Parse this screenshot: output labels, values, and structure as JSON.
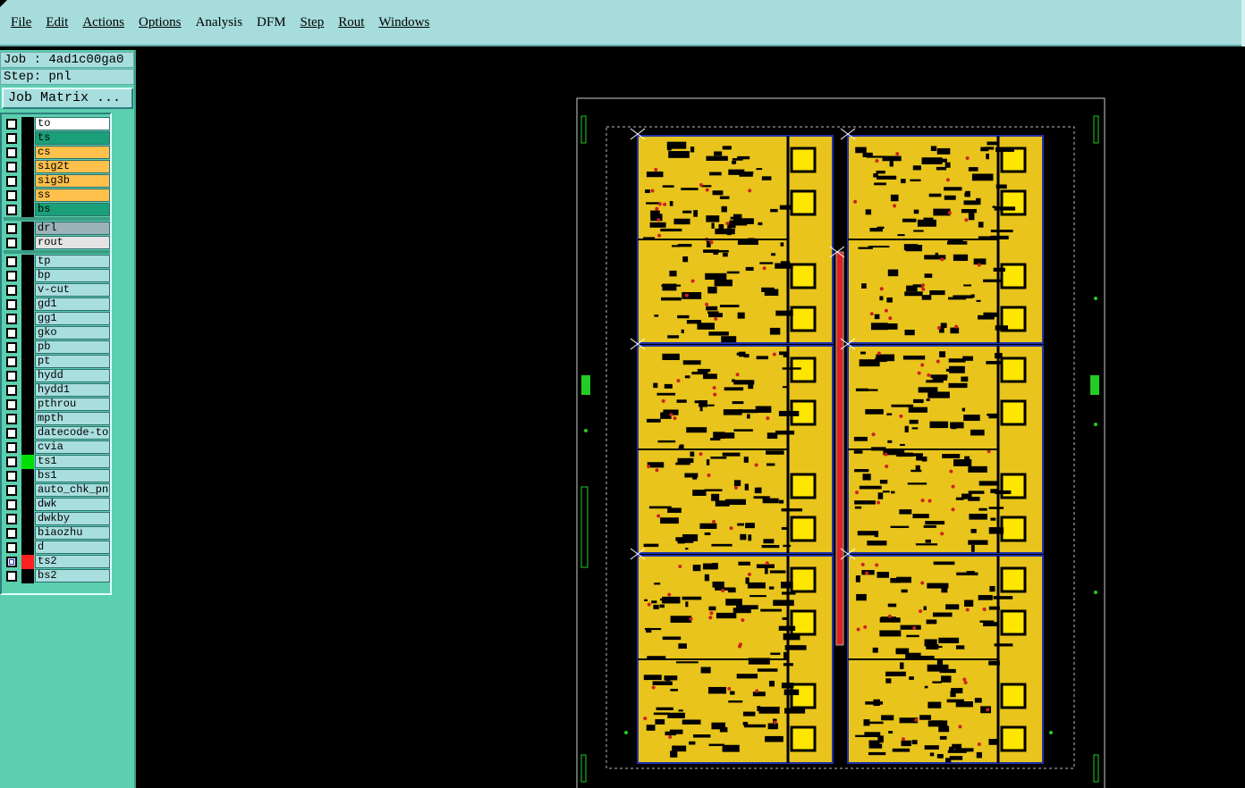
{
  "menu": [
    {
      "label": "File"
    },
    {
      "label": "Edit"
    },
    {
      "label": "Actions"
    },
    {
      "label": "Options"
    },
    {
      "label": "Analysis"
    },
    {
      "label": "DFM"
    },
    {
      "label": "Step"
    },
    {
      "label": "Rout"
    },
    {
      "label": "Windows"
    }
  ],
  "job": {
    "label": "Job : 4ad1c00ga0"
  },
  "step": {
    "label": "Step: pnl"
  },
  "job_matrix": {
    "label": "Job Matrix ..."
  },
  "layers": [
    {
      "name": "to",
      "bg": "#ffffff",
      "swatch": "#000000"
    },
    {
      "name": "ts",
      "bg": "#1aa078",
      "swatch": "#000000"
    },
    {
      "name": "cs",
      "bg": "#ffc04c",
      "swatch": "#000000"
    },
    {
      "name": "sig2t",
      "bg": "#ffc04c",
      "swatch": "#000000"
    },
    {
      "name": "sig3b",
      "bg": "#ffc04c",
      "swatch": "#000000"
    },
    {
      "name": "ss",
      "bg": "#ffc04c",
      "swatch": "#000000"
    },
    {
      "name": "bs",
      "bg": "#1aa078",
      "swatch": "#000000"
    },
    {
      "name": "drl",
      "bg": "#9ab2b8",
      "swatch": "#000000"
    },
    {
      "name": "rout",
      "bg": "#e4e4e4",
      "swatch": "#000000"
    },
    {
      "name": "tp",
      "bg": "#a9dede",
      "swatch": "#000000"
    },
    {
      "name": "bp",
      "bg": "#a9dede",
      "swatch": "#000000"
    },
    {
      "name": "v-cut",
      "bg": "#a9dede",
      "swatch": "#000000"
    },
    {
      "name": "gd1",
      "bg": "#a9dede",
      "swatch": "#000000"
    },
    {
      "name": "gg1",
      "bg": "#a9dede",
      "swatch": "#000000"
    },
    {
      "name": "gko",
      "bg": "#a9dede",
      "swatch": "#000000"
    },
    {
      "name": "pb",
      "bg": "#a9dede",
      "swatch": "#000000"
    },
    {
      "name": "pt",
      "bg": "#a9dede",
      "swatch": "#000000"
    },
    {
      "name": "hydd",
      "bg": "#a9dede",
      "swatch": "#000000"
    },
    {
      "name": "hydd1",
      "bg": "#a9dede",
      "swatch": "#000000"
    },
    {
      "name": "pthrou",
      "bg": "#a9dede",
      "swatch": "#000000"
    },
    {
      "name": "mpth",
      "bg": "#a9dede",
      "swatch": "#000000"
    },
    {
      "name": "datecode-to",
      "bg": "#a9dede",
      "swatch": "#000000"
    },
    {
      "name": "cvia",
      "bg": "#a9dede",
      "swatch": "#000000"
    },
    {
      "name": "ts1",
      "bg": "#a9dede",
      "swatch": "#00e000"
    },
    {
      "name": "bs1",
      "bg": "#a9dede",
      "swatch": "#000000"
    },
    {
      "name": "auto_chk_pn",
      "bg": "#a9dede",
      "swatch": "#000000"
    },
    {
      "name": "dwk",
      "bg": "#a9dede",
      "swatch": "#000000"
    },
    {
      "name": "dwkby",
      "bg": "#a9dede",
      "swatch": "#000000"
    },
    {
      "name": "biaozhu",
      "bg": "#a9dede",
      "swatch": "#000000"
    },
    {
      "name": "d",
      "bg": "#a9dede",
      "swatch": "#000000"
    },
    {
      "name": "ts2",
      "bg": "#a9dede",
      "swatch": "#ff2020",
      "checked": true
    },
    {
      "name": "bs2",
      "bg": "#a9dede",
      "swatch": "#000000"
    }
  ],
  "colors": {
    "copper": "#e8c41c",
    "profile": "#22cc22",
    "outline": "#2233aa",
    "rail": "#dd2222",
    "pad": "#ffe600"
  }
}
